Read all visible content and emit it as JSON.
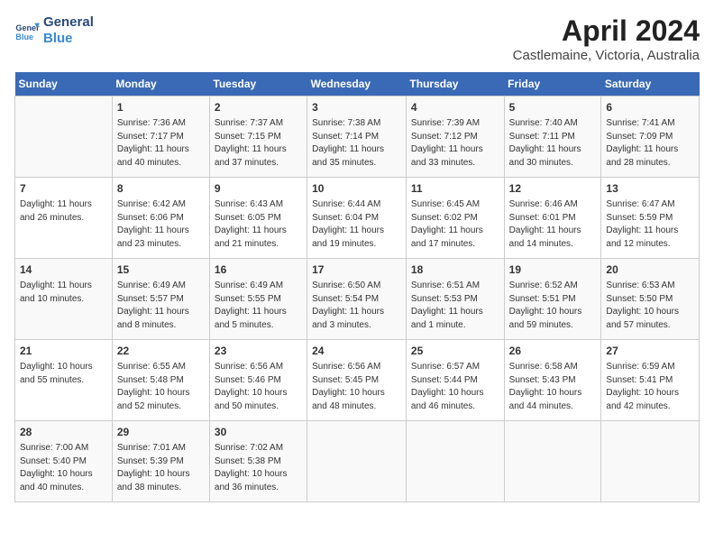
{
  "header": {
    "logo_line1": "General",
    "logo_line2": "Blue",
    "month": "April 2024",
    "location": "Castlemaine, Victoria, Australia"
  },
  "days_of_week": [
    "Sunday",
    "Monday",
    "Tuesday",
    "Wednesday",
    "Thursday",
    "Friday",
    "Saturday"
  ],
  "weeks": [
    [
      {
        "day": "",
        "detail": ""
      },
      {
        "day": "1",
        "detail": "Sunrise: 7:36 AM\nSunset: 7:17 PM\nDaylight: 11 hours\nand 40 minutes."
      },
      {
        "day": "2",
        "detail": "Sunrise: 7:37 AM\nSunset: 7:15 PM\nDaylight: 11 hours\nand 37 minutes."
      },
      {
        "day": "3",
        "detail": "Sunrise: 7:38 AM\nSunset: 7:14 PM\nDaylight: 11 hours\nand 35 minutes."
      },
      {
        "day": "4",
        "detail": "Sunrise: 7:39 AM\nSunset: 7:12 PM\nDaylight: 11 hours\nand 33 minutes."
      },
      {
        "day": "5",
        "detail": "Sunrise: 7:40 AM\nSunset: 7:11 PM\nDaylight: 11 hours\nand 30 minutes."
      },
      {
        "day": "6",
        "detail": "Sunrise: 7:41 AM\nSunset: 7:09 PM\nDaylight: 11 hours\nand 28 minutes."
      }
    ],
    [
      {
        "day": "7",
        "detail": "Daylight: 11 hours\nand 26 minutes."
      },
      {
        "day": "8",
        "detail": "Sunrise: 6:42 AM\nSunset: 6:06 PM\nDaylight: 11 hours\nand 23 minutes."
      },
      {
        "day": "9",
        "detail": "Sunrise: 6:43 AM\nSunset: 6:05 PM\nDaylight: 11 hours\nand 21 minutes."
      },
      {
        "day": "10",
        "detail": "Sunrise: 6:44 AM\nSunset: 6:04 PM\nDaylight: 11 hours\nand 19 minutes."
      },
      {
        "day": "11",
        "detail": "Sunrise: 6:45 AM\nSunset: 6:02 PM\nDaylight: 11 hours\nand 17 minutes."
      },
      {
        "day": "12",
        "detail": "Sunrise: 6:46 AM\nSunset: 6:01 PM\nDaylight: 11 hours\nand 14 minutes."
      },
      {
        "day": "13",
        "detail": "Sunrise: 6:47 AM\nSunset: 5:59 PM\nDaylight: 11 hours\nand 12 minutes."
      }
    ],
    [
      {
        "day": "14",
        "detail": "Daylight: 11 hours\nand 10 minutes."
      },
      {
        "day": "15",
        "detail": "Sunrise: 6:49 AM\nSunset: 5:57 PM\nDaylight: 11 hours\nand 8 minutes."
      },
      {
        "day": "16",
        "detail": "Sunrise: 6:49 AM\nSunset: 5:55 PM\nDaylight: 11 hours\nand 5 minutes."
      },
      {
        "day": "17",
        "detail": "Sunrise: 6:50 AM\nSunset: 5:54 PM\nDaylight: 11 hours\nand 3 minutes."
      },
      {
        "day": "18",
        "detail": "Sunrise: 6:51 AM\nSunset: 5:53 PM\nDaylight: 11 hours\nand 1 minute."
      },
      {
        "day": "19",
        "detail": "Sunrise: 6:52 AM\nSunset: 5:51 PM\nDaylight: 10 hours\nand 59 minutes."
      },
      {
        "day": "20",
        "detail": "Sunrise: 6:53 AM\nSunset: 5:50 PM\nDaylight: 10 hours\nand 57 minutes."
      }
    ],
    [
      {
        "day": "21",
        "detail": "Daylight: 10 hours\nand 55 minutes."
      },
      {
        "day": "22",
        "detail": "Sunrise: 6:55 AM\nSunset: 5:48 PM\nDaylight: 10 hours\nand 52 minutes."
      },
      {
        "day": "23",
        "detail": "Sunrise: 6:56 AM\nSunset: 5:46 PM\nDaylight: 10 hours\nand 50 minutes."
      },
      {
        "day": "24",
        "detail": "Sunrise: 6:56 AM\nSunset: 5:45 PM\nDaylight: 10 hours\nand 48 minutes."
      },
      {
        "day": "25",
        "detail": "Sunrise: 6:57 AM\nSunset: 5:44 PM\nDaylight: 10 hours\nand 46 minutes."
      },
      {
        "day": "26",
        "detail": "Sunrise: 6:58 AM\nSunset: 5:43 PM\nDaylight: 10 hours\nand 44 minutes."
      },
      {
        "day": "27",
        "detail": "Sunrise: 6:59 AM\nSunset: 5:41 PM\nDaylight: 10 hours\nand 42 minutes."
      }
    ],
    [
      {
        "day": "28",
        "detail": "Sunrise: 7:00 AM\nSunset: 5:40 PM\nDaylight: 10 hours\nand 40 minutes."
      },
      {
        "day": "29",
        "detail": "Sunrise: 7:01 AM\nSunset: 5:39 PM\nDaylight: 10 hours\nand 38 minutes."
      },
      {
        "day": "30",
        "detail": "Sunrise: 7:02 AM\nSunset: 5:38 PM\nDaylight: 10 hours\nand 36 minutes."
      },
      {
        "day": "",
        "detail": ""
      },
      {
        "day": "",
        "detail": ""
      },
      {
        "day": "",
        "detail": ""
      },
      {
        "day": "",
        "detail": ""
      }
    ]
  ]
}
